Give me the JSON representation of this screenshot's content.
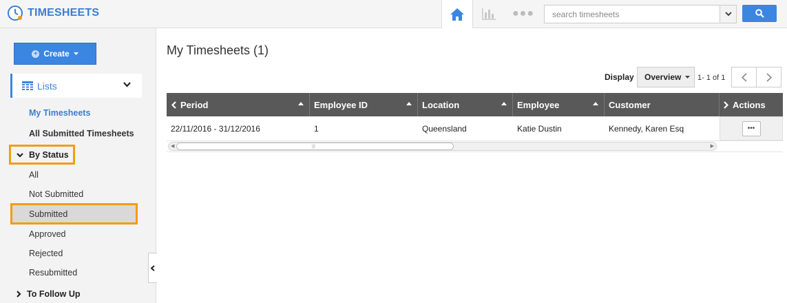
{
  "app": {
    "title": "TIMESHEETS"
  },
  "topbar": {
    "icons": {
      "home": "home-icon",
      "chart": "bar-chart-icon",
      "more": "more-icon",
      "search": "search-icon"
    },
    "search": {
      "placeholder": "search timesheets",
      "value": ""
    },
    "colors": {
      "accent": "#3b86e0"
    }
  },
  "sidebar": {
    "create_label": "Create",
    "lists_label": "Lists",
    "items": [
      {
        "label": "My Timesheets",
        "state": "active"
      },
      {
        "label": "All Submitted Timesheets",
        "state": "bold"
      }
    ],
    "by_status": {
      "label": "By Status",
      "expanded": true,
      "items": [
        {
          "label": "All"
        },
        {
          "label": "Not Submitted"
        },
        {
          "label": "Submitted",
          "selected": true
        },
        {
          "label": "Approved"
        },
        {
          "label": "Rejected"
        },
        {
          "label": "Resubmitted"
        }
      ]
    },
    "to_follow_up": {
      "label": "To Follow Up",
      "expanded": false
    },
    "highlight_color": "#f39c12"
  },
  "main": {
    "title": "My Timesheets (1)",
    "display_label": "Display",
    "display_value": "Overview",
    "pager_text": "1- 1 of 1",
    "columns": [
      "Period",
      "Employee ID",
      "Location",
      "Employee",
      "Customer",
      "Actions"
    ],
    "rows": [
      {
        "period": "22/11/2016 - 31/12/2016",
        "employee_id": "1",
        "location": "Queensland",
        "employee": "Katie Dustin",
        "customer": "Kennedy, Karen Esq",
        "actions": "•••"
      }
    ]
  }
}
